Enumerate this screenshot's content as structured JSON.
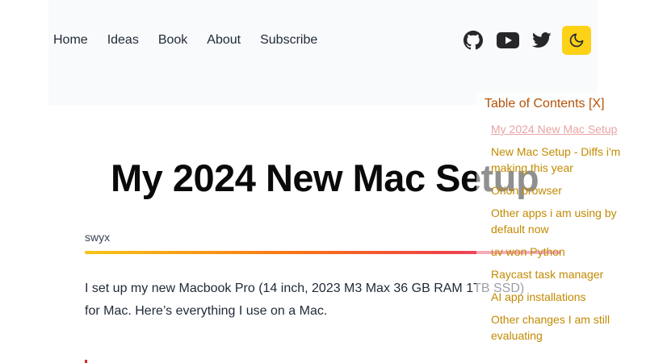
{
  "nav": {
    "items": [
      {
        "label": "Home"
      },
      {
        "label": "Ideas"
      },
      {
        "label": "Book"
      },
      {
        "label": "About"
      },
      {
        "label": "Subscribe"
      }
    ]
  },
  "social": {
    "icons": [
      "github-icon",
      "youtube-icon",
      "twitter-icon"
    ],
    "theme_toggle_icon": "moon-icon",
    "theme_toggle_color": "#fcd116"
  },
  "article": {
    "title": "My 2024 New Mac Setup",
    "author": "swyx",
    "intro": "I set up my new Macbook Pro (14 inch, 2023 M3 Max 36 GB RAM 1TB SSD) for Mac. Here’s everything I use on a Mac."
  },
  "toc": {
    "title": "Table of Contents [X]",
    "items": [
      "My 2024 New Mac Setup",
      "New Mac Setup - Diffs i'm making this year",
      "Orion browser",
      "Other apps i am using by default now",
      "uv won Python",
      "Raycast task manager",
      "AI app installations",
      "Other changes I am still evaluating"
    ],
    "active_index": 0
  },
  "colors": {
    "toc_link": "#c28a00",
    "toc_title": "#b45309",
    "gradient": [
      "#f5c518",
      "#f97316",
      "#ef4444",
      "#ec4899"
    ]
  }
}
